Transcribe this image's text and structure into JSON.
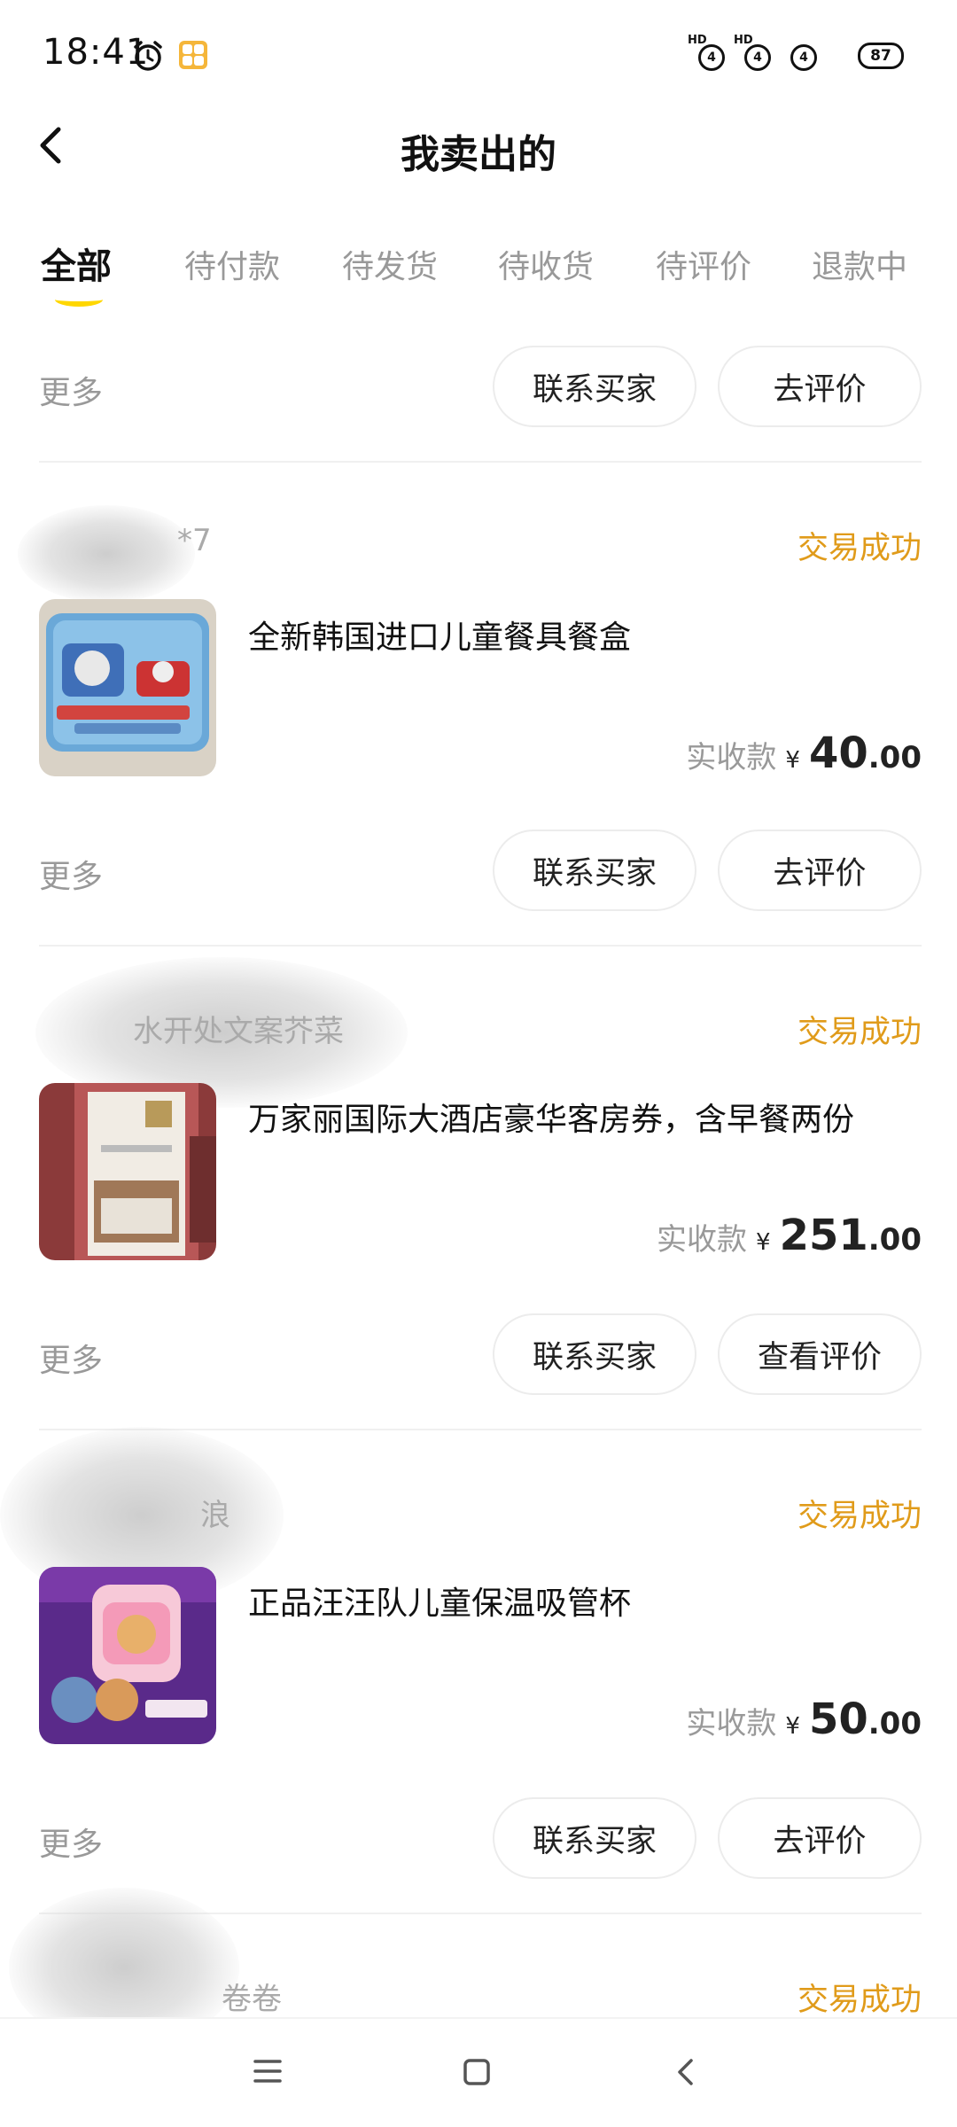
{
  "status_bar": {
    "time": "18:41",
    "icons": [
      "alarm-icon",
      "app-notification-icon"
    ],
    "signal": [
      {
        "label": "HD",
        "value": "4"
      },
      {
        "label": "HD",
        "value": "4"
      },
      {
        "label": "",
        "value": "4"
      }
    ],
    "battery": "87"
  },
  "header": {
    "back_icon": "chevron-left-icon",
    "title": "我卖出的"
  },
  "tabs": [
    {
      "label": "全部",
      "active": true
    },
    {
      "label": "待付款",
      "active": false
    },
    {
      "label": "待发货",
      "active": false
    },
    {
      "label": "待收货",
      "active": false
    },
    {
      "label": "待评价",
      "active": false
    },
    {
      "label": "退款中",
      "active": false
    }
  ],
  "top_actions": {
    "more": "更多",
    "contact": "联系买家",
    "review": "去评价"
  },
  "orders": [
    {
      "buyer": "*7",
      "status": "交易成功",
      "title": "全新韩国进口儿童餐具餐盒",
      "price_label": "实收款",
      "currency": "¥",
      "price_int": "40",
      "price_dec": ".00",
      "more": "更多",
      "contact": "联系买家",
      "review": "去评价"
    },
    {
      "buyer": "水开处文案芥菜",
      "status": "交易成功",
      "title": "万家丽国际大酒店豪华客房券，含早餐两份",
      "price_label": "实收款",
      "currency": "¥",
      "price_int": "251",
      "price_dec": ".00",
      "more": "更多",
      "contact": "联系买家",
      "review": "查看评价"
    },
    {
      "buyer": "浪",
      "status": "交易成功",
      "title": "正品汪汪队儿童保温吸管杯",
      "price_label": "实收款",
      "currency": "¥",
      "price_int": "50",
      "price_dec": ".00",
      "more": "更多",
      "contact": "联系买家",
      "review": "去评价"
    },
    {
      "buyer": "卷卷",
      "status": "交易成功"
    }
  ],
  "colors": {
    "accent_yellow": "#ffd700",
    "status_orange": "#e09b1a",
    "muted_gray": "#999999"
  },
  "nav_bar": {
    "icons": [
      "menu-icon",
      "home-square-icon",
      "back-triangle-icon"
    ]
  }
}
